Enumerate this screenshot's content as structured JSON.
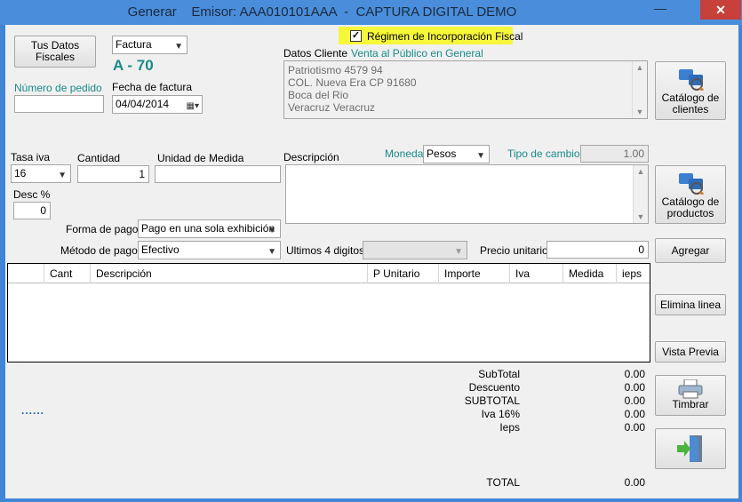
{
  "window": {
    "title": "Generar    Emisor: AAA010101AAA  -  CAPTURA DIGITAL DEMO",
    "minimize_glyph": "—",
    "close_glyph": "✕"
  },
  "header": {
    "tus_datos_button": "Tus Datos Fiscales",
    "doc_type": "Factura",
    "folio": "A - 70",
    "pedido_label": "Número de pedido",
    "pedido_value": "",
    "fecha_label": "Fecha de factura",
    "fecha_value": "04/04/2014",
    "regimen_label": "Régimen de Incorporación Fiscal",
    "regimen_checked": true
  },
  "cliente": {
    "label": "Datos Cliente",
    "link": "Venta al Público en General",
    "address_lines": [
      "Patriotismo 4579 94",
      "COL. Nueva Era   CP 91680",
      "Boca del Rio",
      "Veracruz   Veracruz"
    ],
    "catalog_button": "Catálogo de clientes"
  },
  "item_entry": {
    "tasa_iva_label": "Tasa iva",
    "tasa_iva_value": "16",
    "cantidad_label": "Cantidad",
    "cantidad_value": "1",
    "unidad_label": "Unidad de Medida",
    "unidad_value": "",
    "desc_pct_label": "Desc %",
    "desc_pct_value": "0",
    "descripcion_label": "Descripción",
    "moneda_label": "Moneda",
    "moneda_value": "Pesos",
    "tipo_cambio_label": "Tipo de cambio",
    "tipo_cambio_value": "1.00",
    "catalog_products_button": "Catálogo de productos",
    "forma_pago_label": "Forma de pago",
    "forma_pago_value": "Pago en una sola exhibición",
    "metodo_pago_label": "Método de pago",
    "metodo_pago_value": "Efectivo",
    "ultimos_label": "Ultimos 4 digitos",
    "ultimos_value": "",
    "precio_label": "Precio unitario",
    "precio_value": "0",
    "agregar_button": "Agregar"
  },
  "grid": {
    "columns": [
      "Cant",
      "Descripción",
      "P Unitario",
      "Importe",
      "Iva",
      "Medida",
      "ieps"
    ],
    "rows": []
  },
  "actions": {
    "elimina_button": "Elimina linea",
    "vista_button": "Vista Previa",
    "timbrar_button": "Timbrar",
    "dots": "......"
  },
  "totals": {
    "subtotal_label": "SubTotal",
    "subtotal_value": "0.00",
    "descuento_label": "Descuento",
    "descuento_value": "0.00",
    "subtotal2_label": "SUBTOTAL",
    "subtotal2_value": "0.00",
    "iva_label": "Iva 16%",
    "iva_value": "0.00",
    "ieps_label": "Ieps",
    "ieps_value": "0.00",
    "total_label": "TOTAL",
    "total_value": "0.00"
  },
  "colors": {
    "title_bar": "#4a8edb",
    "close_button": "#c7403a",
    "highlight": "#f7f73a",
    "teal_text": "#1a8a8a"
  }
}
